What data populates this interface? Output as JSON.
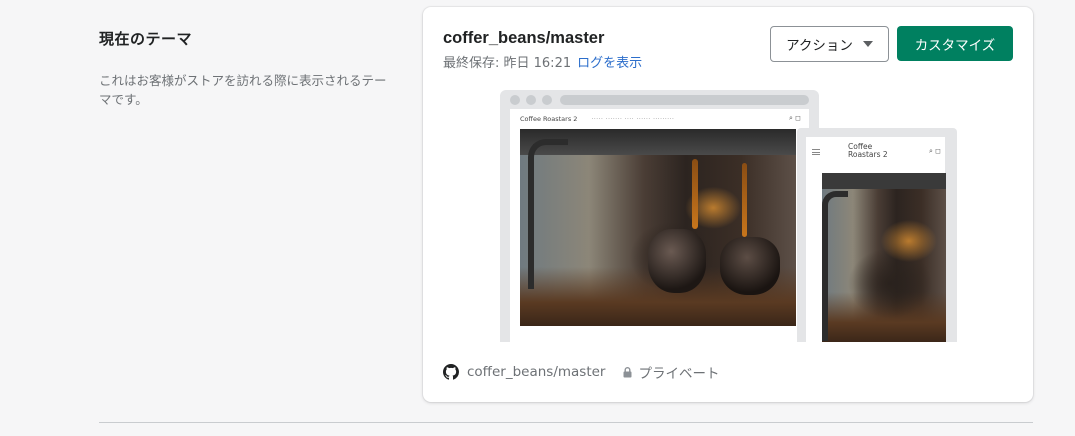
{
  "section": {
    "title": "現在のテーマ",
    "description": "これはお客様がストアを訪れる際に表示されるテーマです。"
  },
  "theme": {
    "name": "coffer_beans/master",
    "saved_label": "最終保存: 昨日 16:21",
    "log_link": "ログを表示",
    "actions_label": "アクション",
    "customize_label": "カスタマイズ",
    "repo": "coffer_beans/master",
    "visibility": "プライベート"
  },
  "preview": {
    "desktop_logo": "Coffee Roastars 2",
    "desktop_links": "Coffee Roastars 2 ···· ······ ········",
    "mobile_logo_line1": "Coffee",
    "mobile_logo_line2": "Roastars 2"
  },
  "colors": {
    "primary": "#008060",
    "link": "#2c6ecb",
    "background": "#f6f6f7"
  }
}
